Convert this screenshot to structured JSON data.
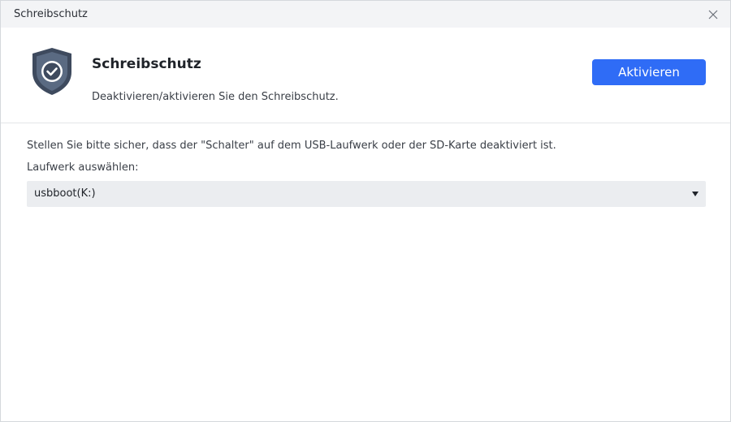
{
  "window": {
    "title": "Schreibschutz"
  },
  "header": {
    "feature_title": "Schreibschutz",
    "feature_description": "Deaktivieren/aktivieren Sie den Schreibschutz.",
    "action_button_label": "Aktivieren",
    "icon": "shield-check-icon",
    "accent_color": "#2f6cf6"
  },
  "content": {
    "info_text": "Stellen Sie bitte sicher, dass der \"Schalter\" auf dem USB-Laufwerk oder der SD-Karte deaktiviert ist.",
    "drive_label": "Laufwerk auswählen:",
    "drive_select": {
      "selected": "usbboot(K:)"
    }
  }
}
